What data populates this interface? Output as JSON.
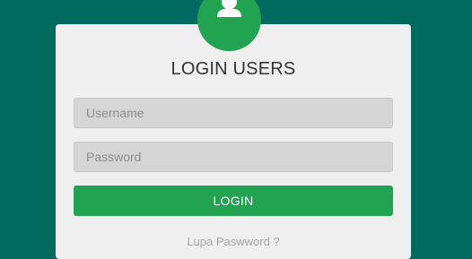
{
  "colors": {
    "background": "#00695f",
    "card": "#efefef",
    "accent": "#21a352",
    "input_bg": "#d5d5d5"
  },
  "header": {
    "avatar_icon": "user-icon",
    "title": "LOGIN USERS"
  },
  "form": {
    "username": {
      "placeholder": "Username",
      "value": ""
    },
    "password": {
      "placeholder": "Password",
      "value": ""
    },
    "login_label": "LOGIN",
    "forgot_label": "Lupa Paswword ?"
  }
}
